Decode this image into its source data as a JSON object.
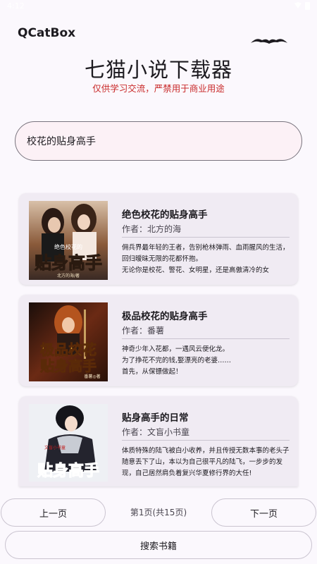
{
  "status_bar": {
    "time": "4:12"
  },
  "app": {
    "name": "QCatBox"
  },
  "header": {
    "title": "七猫小说下载器",
    "subtitle": "仅供学习交流，严禁用于商业用途"
  },
  "search": {
    "value": "校花的贴身高手"
  },
  "results": [
    {
      "title": "绝色校花的贴身高手",
      "author": "作者：北方的海",
      "description": "佣兵界最年轻的王者，告别枪林弹雨、血雨腥风的生活，回归暧昧无限的花都怀抱。\n无论你是校花、警花、女明星，还是高傲清冷的女",
      "cover": {
        "top_text": "绝色校花的",
        "main_text": "贴身高手",
        "author_text": "北方的海/著",
        "palette": [
          "#3a2a24",
          "#8a5a3a",
          "#d8c0a8"
        ]
      }
    },
    {
      "title": "极品校花的贴身高手",
      "author": "作者：番薯",
      "description": "神奇少年入花都，一遇风云便化龙。\n为了挣花不完的钱,娶漂亮的老婆……\n首先，从保镖做起！",
      "cover": {
        "top_text": "极品校花",
        "main_text": "贴身高手",
        "author_text": "番薯◎著",
        "palette": [
          "#1a0e0a",
          "#6b2a14",
          "#e0a060"
        ]
      }
    },
    {
      "title": "贴身高手的日常",
      "author": "作者：文盲小书童",
      "description": "体质特殊的陆飞被白小收养，并且传授无数本事的老头子随意丢下了山，本以为自己很平凡的陆飞，一步步的发现，自己居然肩负着复兴华夏修行界的大任!",
      "cover": {
        "top_text": "文盲小书童",
        "main_text": "贴身高手",
        "author_text": "",
        "palette": [
          "#f0f0f0",
          "#2a2a34",
          "#7a8aa0"
        ]
      }
    }
  ],
  "pagination": {
    "prev_label": "上一页",
    "indicator": "第1页(共15页)",
    "next_label": "下一页"
  },
  "actions": {
    "search_books_label": "搜索书籍"
  },
  "colors": {
    "background": "#fbf8fd",
    "card": "#f0ebf3",
    "warning_text": "#c92a2a",
    "outline": "#79747e"
  }
}
